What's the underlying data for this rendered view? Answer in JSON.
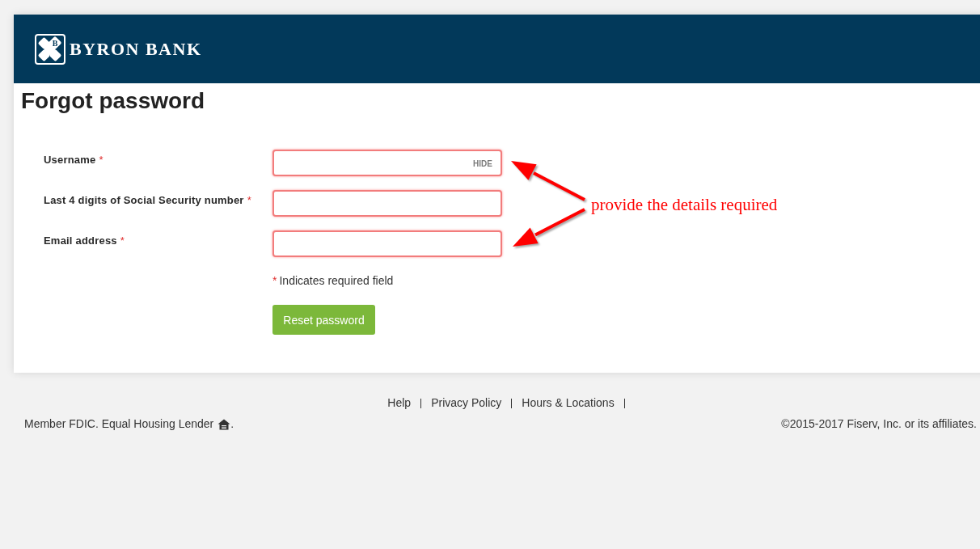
{
  "header": {
    "logo_mark": "B",
    "logo_text": "BYRON BANK"
  },
  "title": "Forgot password",
  "form": {
    "fields": [
      {
        "label": "Username",
        "required_mark": "*",
        "invalid": true,
        "action": "HIDE"
      },
      {
        "label": "Last 4 digits of Social Security number",
        "required_mark": "*",
        "invalid": true
      },
      {
        "label": "Email address",
        "required_mark": "*",
        "invalid": true
      }
    ],
    "required_note": {
      "mark": "*",
      "text": "Indicates required field"
    },
    "submit_button": "Reset password"
  },
  "annotation": {
    "text": "provide the details required"
  },
  "footer": {
    "links": [
      "Help",
      "Privacy Policy",
      "Hours & Locations"
    ],
    "disclosure": "Member FDIC. Equal Housing Lender",
    "disclosure_end": ".",
    "copyright": "©2015-2017 Fiserv, Inc. or its affiliates."
  }
}
